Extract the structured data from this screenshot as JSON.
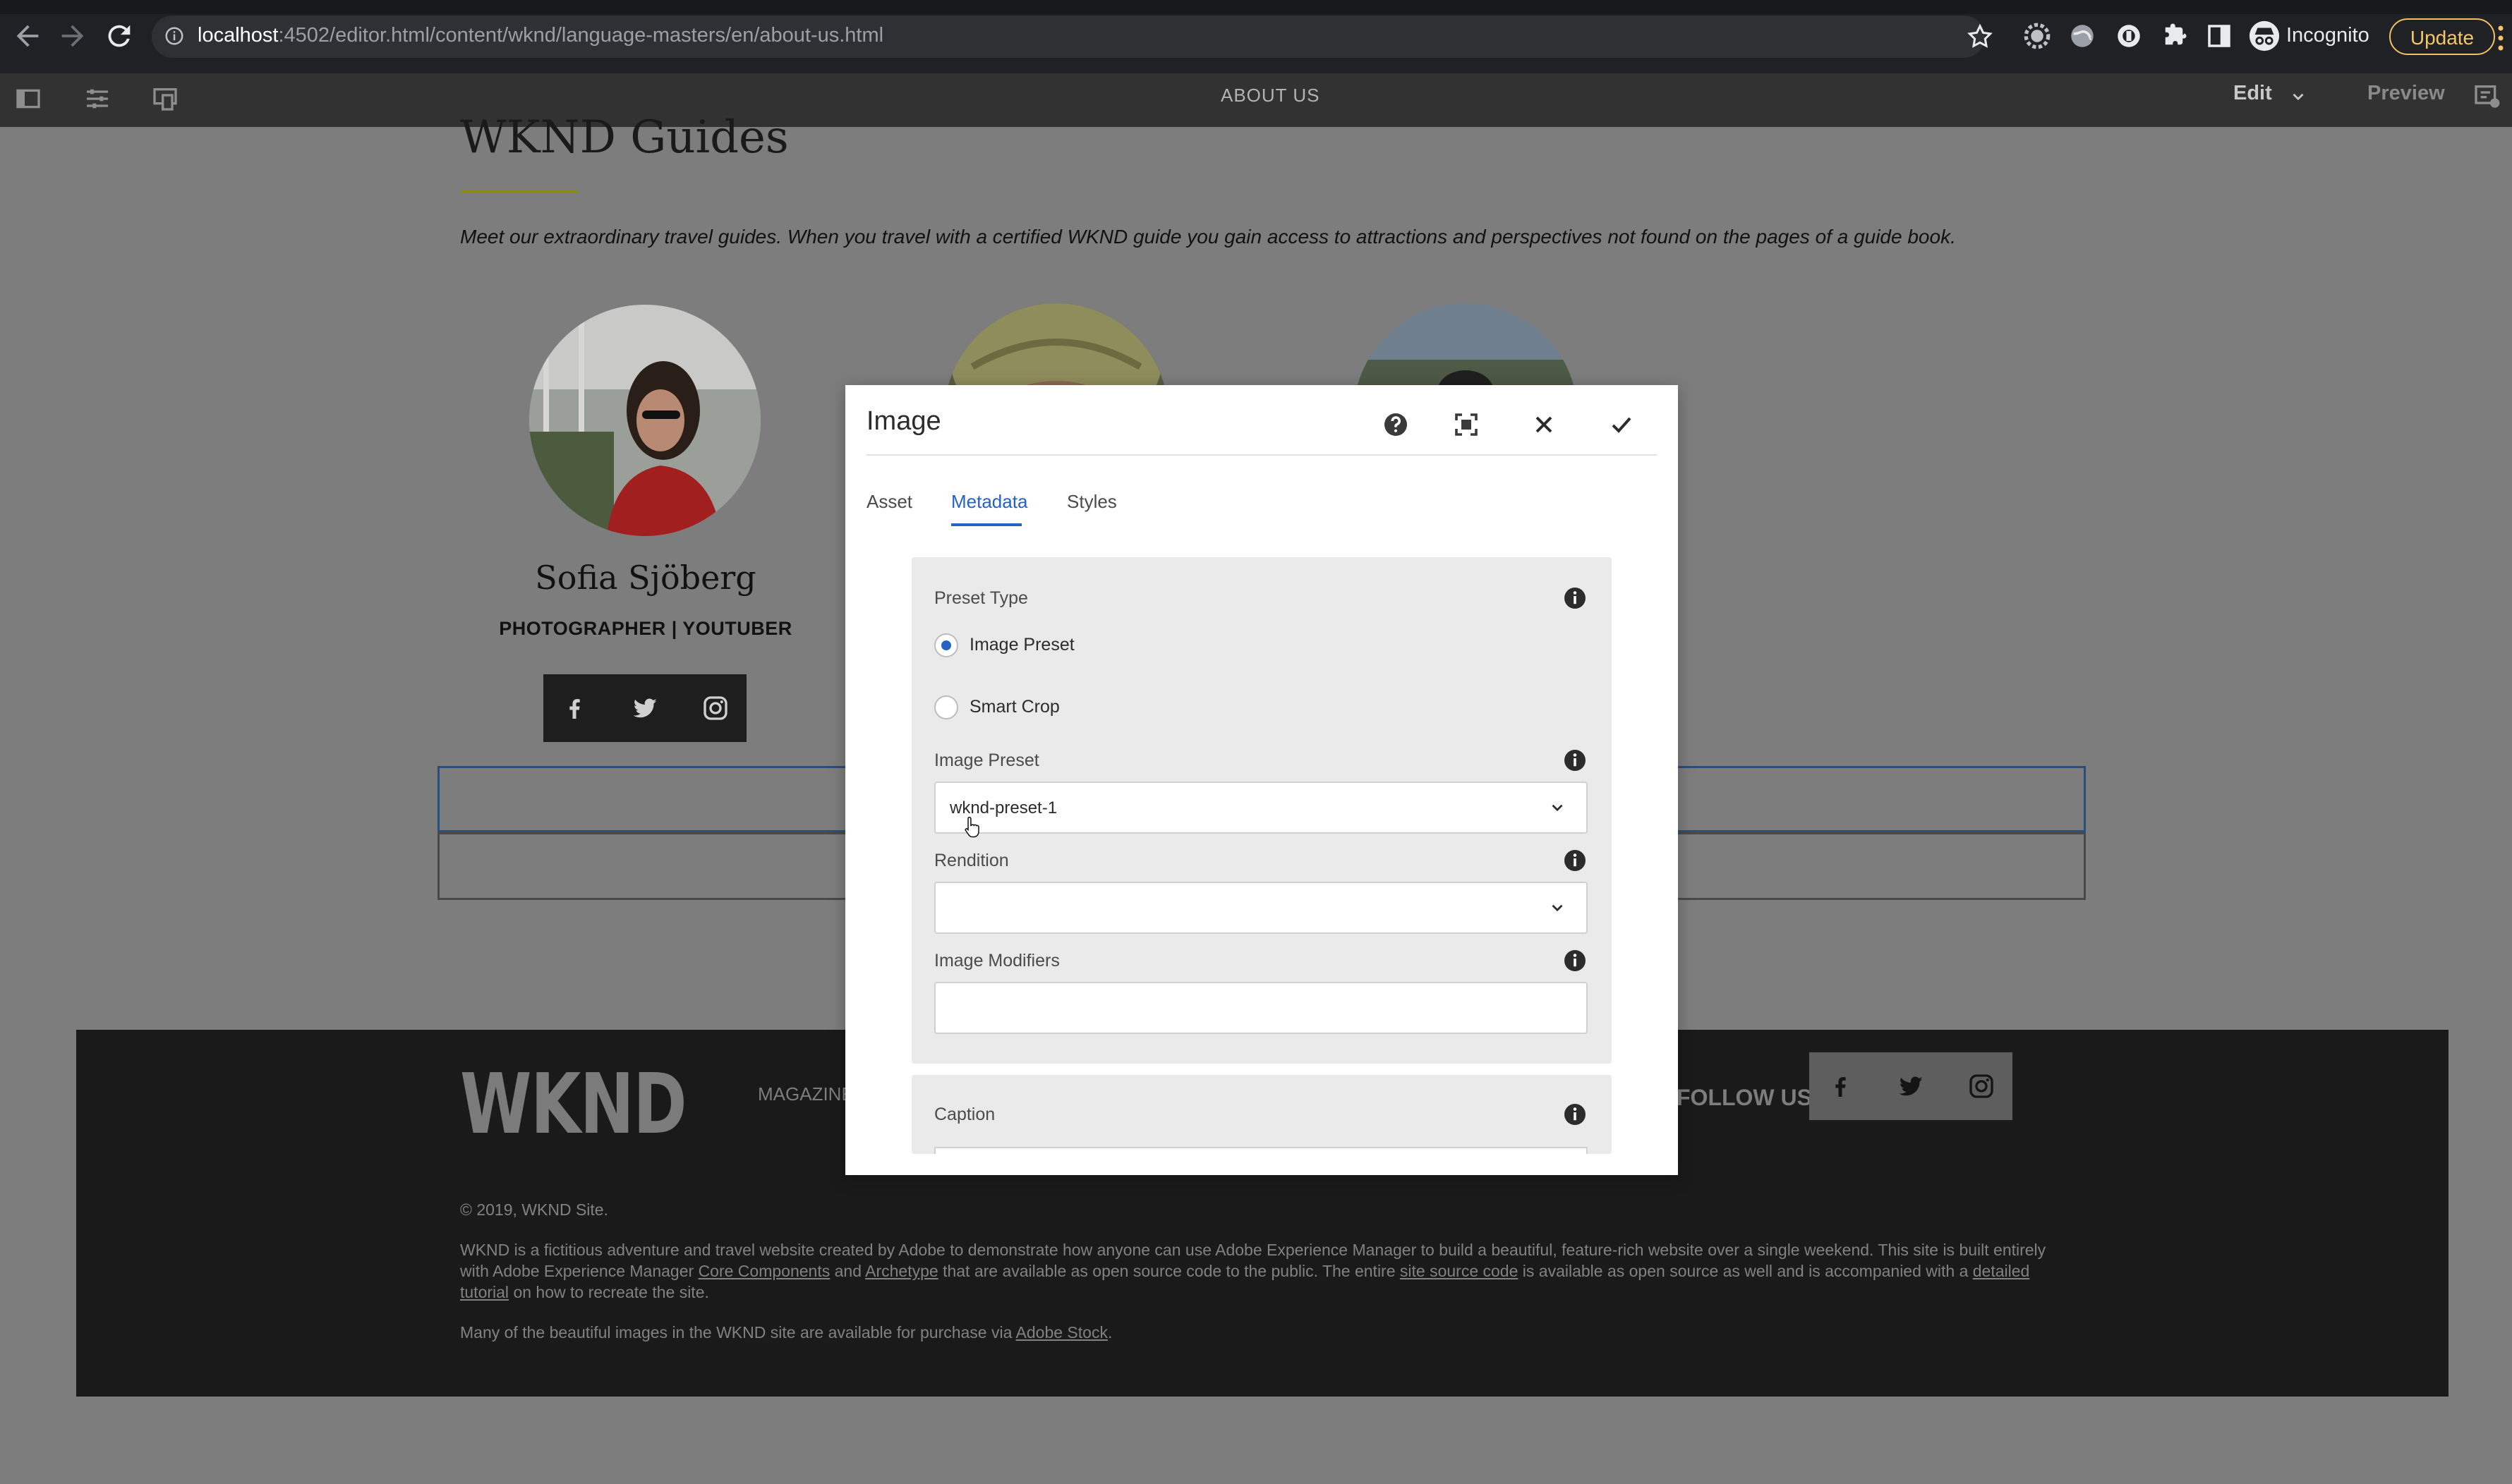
{
  "browser": {
    "url_host": "localhost",
    "url_path": ":4502/editor.html/content/wknd/language-masters/en/about-us.html",
    "incognito_label": "Incognito",
    "update_label": "Update",
    "accent_update": "#f2c063"
  },
  "aem_toolbar": {
    "page_title": "ABOUT US",
    "mode_label": "Edit",
    "preview_label": "Preview"
  },
  "page": {
    "heading": "WKND Guides",
    "intro": "Meet our extraordinary travel guides. When you travel with a certified WKND guide you gain access to attractions and perspectives not found on the pages of a guide book.",
    "guide": {
      "name": "Sofia Sjöberg",
      "role": "PHOTOGRAPHER | YOUTUBER"
    }
  },
  "footer": {
    "logo": "WKND",
    "nav_item": "MAGAZINE",
    "follow_us": "FOLLOW US",
    "copyright": "© 2019,  WKND Site.",
    "about_1": "WKND is a fictitious adventure and travel website created by Adobe to demonstrate how anyone can use Adobe Experience Manager to build a beautiful, feature-rich website over a single weekend. This site is built entirely with",
    "about_2a": "Adobe Experience Manager",
    "link_core_components": "Core Components",
    "about_2b": "and",
    "link_archetype": "Archetype",
    "about_2c": "that are available as open source code to the public. The entire",
    "link_site_source": "site source code",
    "about_2d": "is available as open source as well and is accompanied with a",
    "link_tutorial": "detailed tutorial",
    "about_2e": "on how",
    "about_3": "to recreate the site.",
    "stock_text": "Many of the beautiful images in the WKND site are available for purchase via",
    "link_adobe_stock": "Adobe Stock",
    "stock_end": "."
  },
  "dialog": {
    "title": "Image",
    "tabs": [
      {
        "label": "Asset",
        "active": false
      },
      {
        "label": "Metadata",
        "active": true
      },
      {
        "label": "Styles",
        "active": false
      }
    ],
    "preset_type_label": "Preset Type",
    "radio_options": [
      {
        "label": "Image Preset",
        "selected": true
      },
      {
        "label": "Smart Crop",
        "selected": false
      }
    ],
    "image_preset_label": "Image Preset",
    "image_preset_value": "wknd-preset-1",
    "rendition_label": "Rendition",
    "rendition_value": "",
    "image_modifiers_label": "Image Modifiers",
    "image_modifiers_value": "",
    "caption_label": "Caption",
    "accent": "#2662c4"
  }
}
